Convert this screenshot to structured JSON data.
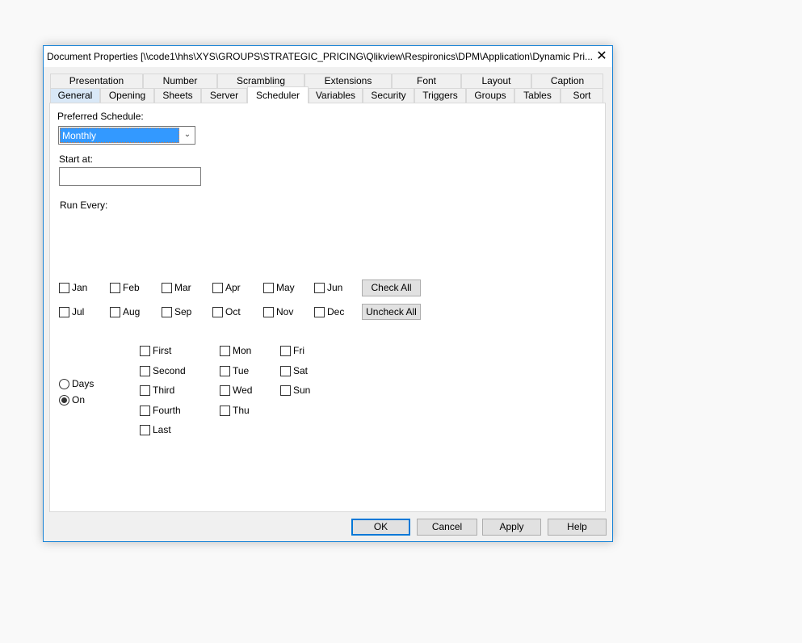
{
  "window": {
    "title": "Document Properties [\\\\code1\\hhs\\XYS\\GROUPS\\STRATEGIC_PRICING\\Qlikview\\Respironics\\DPM\\Application\\Dynamic Pri...",
    "close_icon": "close-icon"
  },
  "tabs_row1": [
    "Presentation",
    "Number",
    "Scrambling",
    "Extensions",
    "Font",
    "Layout",
    "Caption"
  ],
  "tabs_row2": [
    "General",
    "Opening",
    "Sheets",
    "Server",
    "Scheduler",
    "Variables",
    "Security",
    "Triggers",
    "Groups",
    "Tables",
    "Sort"
  ],
  "active_tab": "Scheduler",
  "scheduler": {
    "preferred_label": "Preferred Schedule:",
    "preferred_value": "Monthly",
    "start_label": "Start at:",
    "start_value": "",
    "run_every_label": "Run Every:",
    "months": [
      {
        "label": "Jan",
        "checked": false
      },
      {
        "label": "Feb",
        "checked": false
      },
      {
        "label": "Mar",
        "checked": false
      },
      {
        "label": "Apr",
        "checked": false
      },
      {
        "label": "May",
        "checked": false
      },
      {
        "label": "Jun",
        "checked": false
      },
      {
        "label": "Jul",
        "checked": false
      },
      {
        "label": "Aug",
        "checked": false
      },
      {
        "label": "Sep",
        "checked": false
      },
      {
        "label": "Oct",
        "checked": false
      },
      {
        "label": "Nov",
        "checked": false
      },
      {
        "label": "Dec",
        "checked": false
      }
    ],
    "check_all": "Check All",
    "uncheck_all": "Uncheck All",
    "radios": [
      {
        "label": "Days",
        "selected": false
      },
      {
        "label": "On",
        "selected": true
      }
    ],
    "ordinals": [
      "First",
      "Second",
      "Third",
      "Fourth",
      "Last"
    ],
    "weekdays_col1": [
      "Mon",
      "Tue",
      "Wed",
      "Thu"
    ],
    "weekdays_col2": [
      "Fri",
      "Sat",
      "Sun"
    ]
  },
  "footer": {
    "ok": "OK",
    "cancel": "Cancel",
    "apply": "Apply",
    "help": "Help"
  }
}
